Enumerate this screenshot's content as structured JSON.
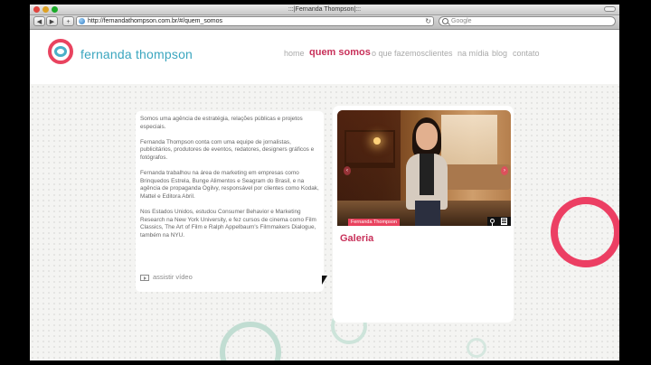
{
  "browser": {
    "window_title": ":::|Fernanda Thompson|:::",
    "url": "http://fernandathompson.com.br/#/quem_somos",
    "search_placeholder": "Google",
    "back_icon": "◀",
    "forward_icon": "▶",
    "add_icon": "+",
    "reload_icon": "↻"
  },
  "site": {
    "logo_text": "fernanda thompson",
    "nav": [
      {
        "label": "home",
        "active": false
      },
      {
        "label": "quem somos",
        "active": true
      },
      {
        "label": "o que fazemos",
        "active": false
      },
      {
        "label": "clientes",
        "active": false
      },
      {
        "label": "na mídia",
        "active": false
      },
      {
        "label": "blog",
        "active": false
      },
      {
        "label": "contato",
        "active": false
      }
    ],
    "paragraphs": [
      "Somos uma agência de estratégia, relações públicas e projetos especiais.",
      "Fernanda Thompson conta com uma equipe de jornalistas, publicitários, produtores de eventos, redatores, designers gráficos e fotógrafos.",
      "Fernanda trabalhou na área de marketing em empresas como Brinquedos Estrela, Bunge Alimentos e Seagram do Brasil, e na agência de propaganda Ogilvy, responsável por clientes como Kodak, Mattel e Editora Abril.",
      "Nos Estados Unidos, estudou Consumer Behavior e Marketing Research na New York University, e fez cursos de cinema como Film Classics, The Art of Film e Ralph Appelbaum's Filmmakers Dialogue, também na NYU."
    ],
    "video_link": "assistir vídeo",
    "gallery": {
      "caption": "Fernanda Thompson",
      "title": "Galeria",
      "prev_icon": "‹",
      "next_icon": "›"
    }
  },
  "colors": {
    "brand_red": "#e9435f",
    "brand_teal": "#3ba6bf",
    "accent_magenta": "#c8315a"
  }
}
